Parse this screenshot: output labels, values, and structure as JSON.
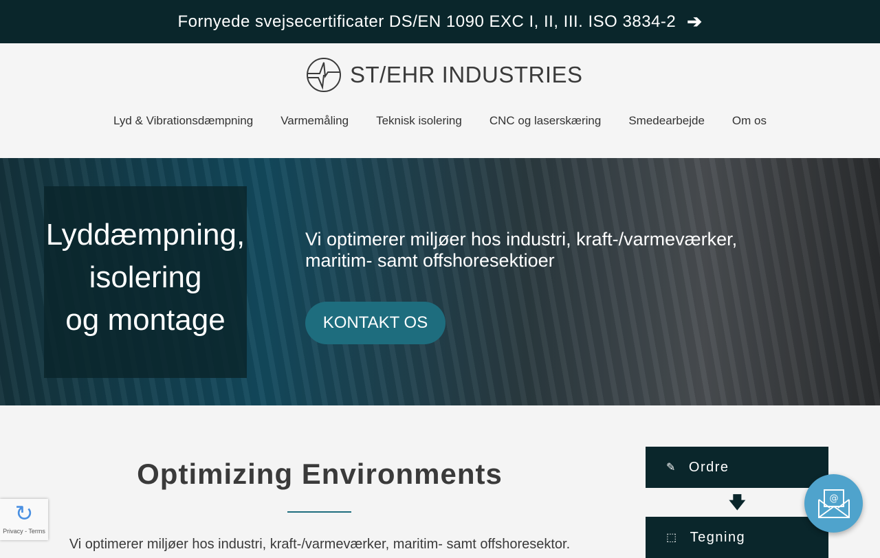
{
  "announcement": {
    "text": "Fornyede svejsecertificater DS/EN 1090 EXC I, II, III. ISO 3834-2",
    "icon": "arrow-right-icon"
  },
  "logo": {
    "text": "ST/EHR INDUSTRIES"
  },
  "nav": [
    "Lyd & Vibrationsdæmpning",
    "Varmemåling",
    "Teknisk isolering",
    "CNC og laserskæring",
    "Smedearbejde",
    "Om os"
  ],
  "hero": {
    "lines": [
      "Lyddæmpning,",
      "isolering",
      "og montage"
    ],
    "subtitle": "Vi optimerer miljøer hos industri, kraft-/varmeværker, maritim- samt offshoresektioer",
    "cta": "KONTAKT OS"
  },
  "main": {
    "title": "Optimizing Environments",
    "text": "Vi optimerer miljøer hos industri, kraft-/varmeværker, maritim- samt offshoresektor."
  },
  "steps": [
    {
      "label": "Ordre",
      "icon": "edit-icon"
    },
    {
      "label": "Tegning",
      "icon": "drawing-icon"
    }
  ],
  "recaptcha": {
    "text": "Privacy - Terms"
  }
}
